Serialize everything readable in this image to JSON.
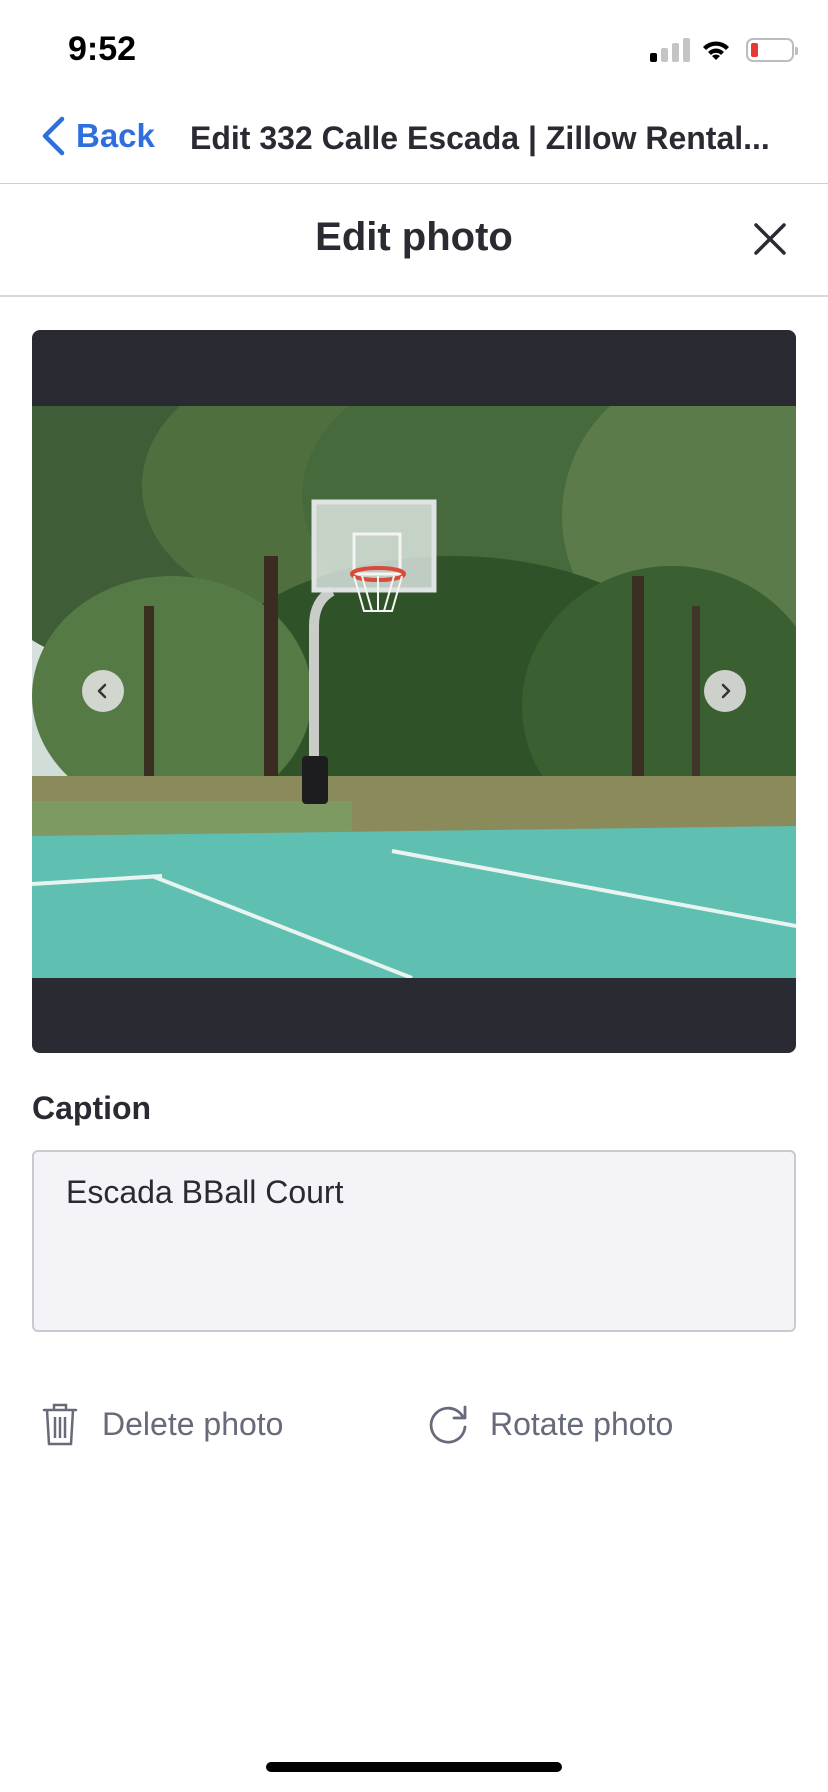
{
  "status_bar": {
    "time": "9:52"
  },
  "nav": {
    "back_label": "Back",
    "title": "Edit 332 Calle Escada | Zillow Rental..."
  },
  "modal": {
    "title": "Edit photo"
  },
  "caption": {
    "label": "Caption",
    "value": "Escada BBall Court"
  },
  "actions": {
    "delete_label": "Delete photo",
    "rotate_label": "Rotate photo"
  },
  "colors": {
    "accent": "#2f6fdd",
    "frame": "#2a2a33",
    "court": "#5fbfb0",
    "battery_low": "#e53935"
  },
  "icons": [
    "signal-icon",
    "wifi-icon",
    "battery-icon",
    "chevron-left-icon",
    "close-icon",
    "arrow-left-icon",
    "arrow-right-icon",
    "trash-icon",
    "rotate-icon"
  ]
}
